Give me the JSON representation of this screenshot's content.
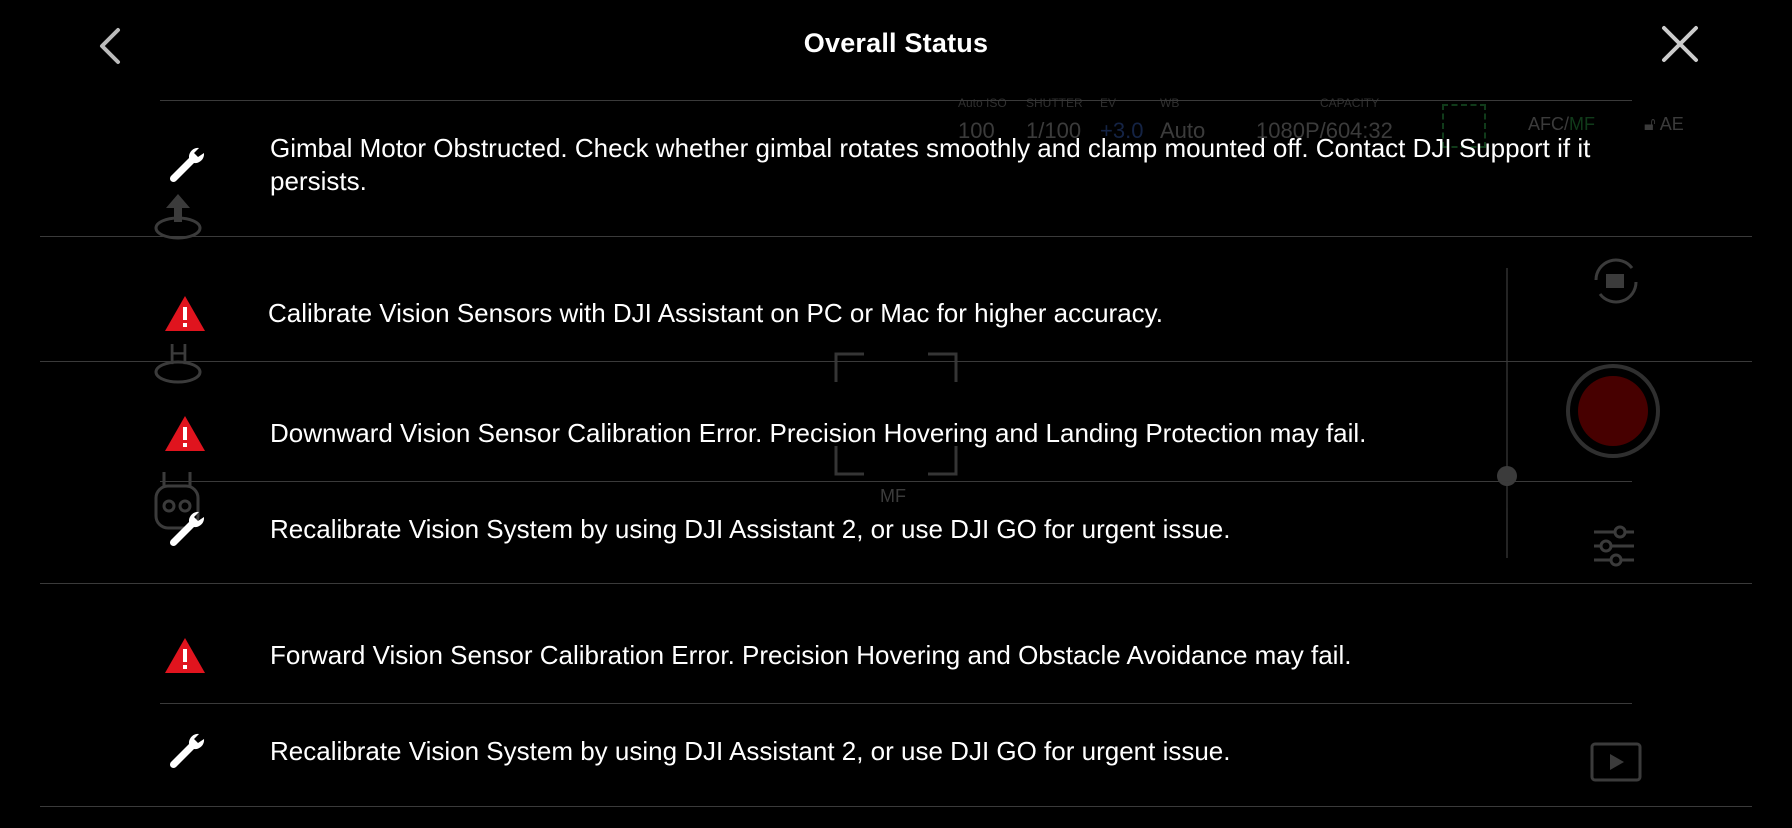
{
  "header": {
    "title": "Overall Status",
    "back_icon": "chevron-left-icon",
    "close_icon": "close-icon"
  },
  "camera_overlay": {
    "iso_label": "Auto ISO",
    "iso_value": "100",
    "shutter_label": "SHUTTER",
    "shutter_value": "1/100",
    "ev_label": "EV",
    "ev_value": "+3.0",
    "wb_label": "WB",
    "wb_value": "Auto",
    "capacity_label": "CAPACITY",
    "resolution_value": "1080P/60",
    "time_value": "4:32",
    "focus_mode": "MF",
    "afc_label": "AFC",
    "mf_label": "MF",
    "ae_label": "AE"
  },
  "items": [
    {
      "icon": "wrench-icon",
      "text": "Gimbal Motor Obstructed. Check whether gimbal rotates smoothly and clamp mounted off. Contact DJI Support if it persists."
    },
    {
      "icon": "warning-icon",
      "text": "Calibrate Vision Sensors with DJI Assistant on PC or Mac for higher accuracy."
    },
    {
      "icon": "warning-icon",
      "text": "Downward Vision Sensor Calibration Error. Precision Hovering and Landing Protection may fail."
    },
    {
      "icon": "wrench-icon",
      "text": "Recalibrate Vision System by using DJI Assistant 2, or use DJI GO for urgent issue."
    },
    {
      "icon": "warning-icon",
      "text": "Forward Vision Sensor Calibration Error. Precision Hovering and Obstacle Avoidance may fail."
    },
    {
      "icon": "wrench-icon",
      "text": "Recalibrate Vision System by using DJI Assistant 2, or use DJI GO for urgent issue."
    }
  ],
  "colors": {
    "background": "#000000",
    "text": "#ffffff",
    "warning": "#e0141e",
    "divider": "#3a3a3a",
    "ev_accent": "#3a66c4",
    "af_accent": "#2ea84a"
  }
}
